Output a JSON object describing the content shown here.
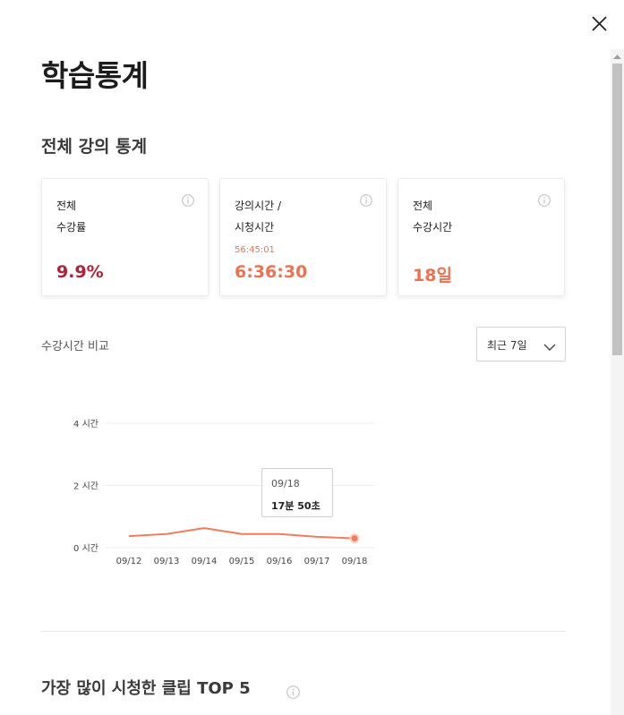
{
  "page": {
    "title": "학습통계",
    "close_icon": "close-icon"
  },
  "overall": {
    "section_title": "전체 강의 통계",
    "cards": [
      {
        "label_line1": "전체",
        "label_line2": "수강률",
        "sub": "",
        "value": "9.9%",
        "value_color": "#b3203a",
        "icon": "info-icon"
      },
      {
        "label_line1": "강의시간 /",
        "label_line2": "시청시간",
        "sub": "56:45:01",
        "value": "6:36:30",
        "value_color": "#f07050",
        "icon": "info-icon"
      },
      {
        "label_line1": "전체",
        "label_line2": "수강시간",
        "sub": "",
        "value": "18일",
        "value_color": "#f07050",
        "icon": "info-icon"
      }
    ]
  },
  "compare": {
    "label": "수강시간 비교",
    "period_selected": "최근 7일",
    "tooltip": {
      "date": "09/18",
      "value": "17분 50초"
    }
  },
  "chart_data": {
    "type": "line",
    "categories": [
      "09/12",
      "09/13",
      "09/14",
      "09/15",
      "09/16",
      "09/17",
      "09/18"
    ],
    "series": [
      {
        "values": [
          0.37,
          0.44,
          0.63,
          0.44,
          0.44,
          0.35,
          0.3
        ]
      }
    ],
    "y_ticks": [
      {
        "value": 0,
        "label": "0 시간"
      },
      {
        "value": 2,
        "label": "2 시간"
      },
      {
        "value": 4,
        "label": "4 시간"
      }
    ],
    "ylim": [
      0,
      4
    ],
    "grid": true,
    "highlight_index": 6,
    "line_color": "#f47b5c"
  },
  "top5": {
    "title": "가장 많이 시청한 클립 TOP 5"
  }
}
